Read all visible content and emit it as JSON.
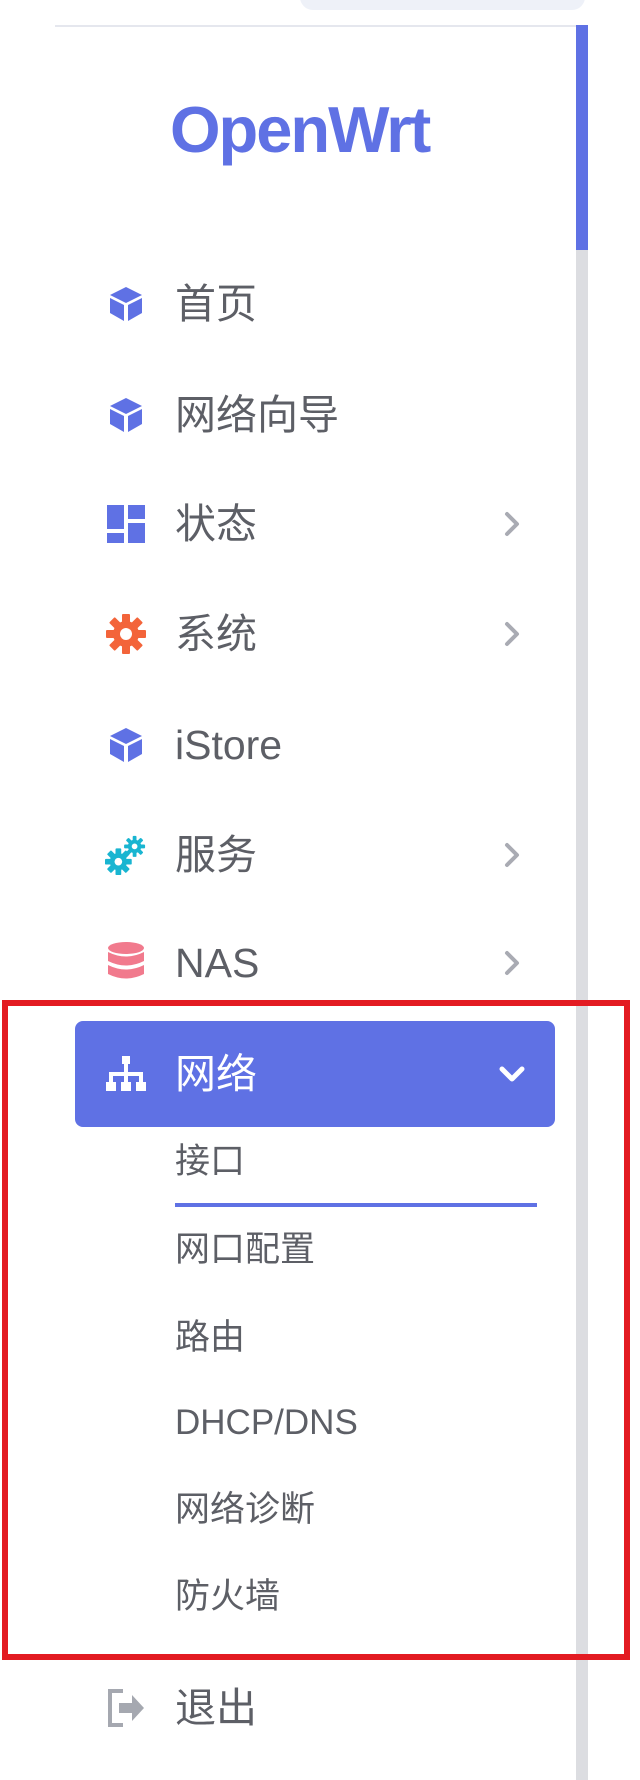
{
  "app": {
    "logo_text": "OpenWrt",
    "accent_color": "#5f71e4",
    "highlight_color": "#e31b22"
  },
  "nav": {
    "items": [
      {
        "label": "首页",
        "icon": "cube-icon",
        "icon_color": "#5f71e4",
        "has_chevron": false
      },
      {
        "label": "网络向导",
        "icon": "cube-icon",
        "icon_color": "#5f71e4",
        "has_chevron": false
      },
      {
        "label": "状态",
        "icon": "dashboard-icon",
        "icon_color": "#5f71e4",
        "has_chevron": true
      },
      {
        "label": "系统",
        "icon": "gear-icon",
        "icon_color": "#f3643a",
        "has_chevron": true
      },
      {
        "label": "iStore",
        "icon": "cube-icon",
        "icon_color": "#5f71e4",
        "has_chevron": false
      },
      {
        "label": "服务",
        "icon": "gears-icon",
        "icon_color": "#19b5d1",
        "has_chevron": true
      },
      {
        "label": "NAS",
        "icon": "database-icon",
        "icon_color": "#f17a8d",
        "has_chevron": true
      },
      {
        "label": "网络",
        "icon": "network-icon",
        "icon_color": "#ffffff",
        "has_chevron": true,
        "expanded": true,
        "active": true
      },
      {
        "label": "退出",
        "icon": "logout-icon",
        "icon_color": "#a5a8b0",
        "has_chevron": false
      }
    ],
    "network_submenu": [
      {
        "label": "接口",
        "active": true
      },
      {
        "label": "网口配置",
        "active": false
      },
      {
        "label": "路由",
        "active": false
      },
      {
        "label": "DHCP/DNS",
        "active": false
      },
      {
        "label": "网络诊断",
        "active": false
      },
      {
        "label": "防火墙",
        "active": false
      }
    ]
  }
}
